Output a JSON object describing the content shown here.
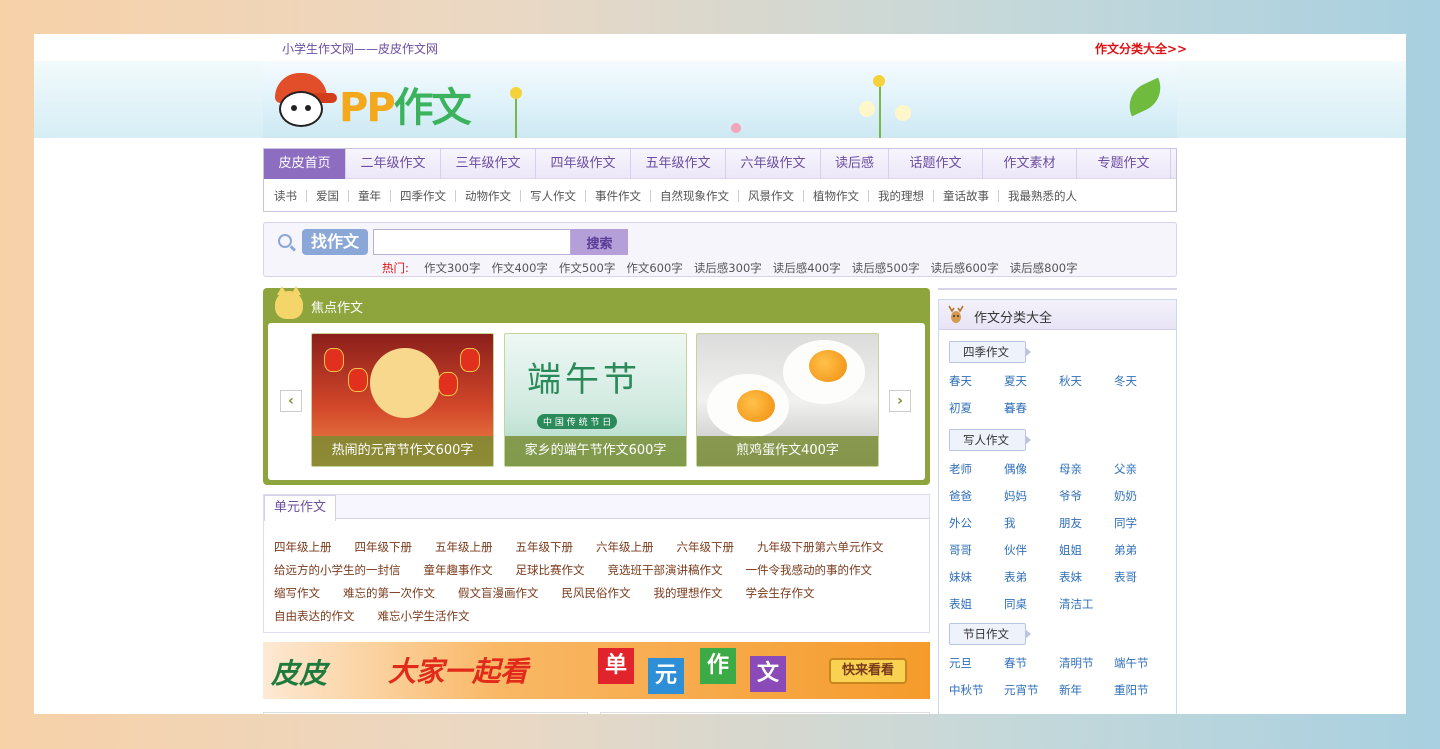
{
  "topbar": {
    "site_name": "小学生作文网——皮皮作文网",
    "all_categories": "作文分类大全>>"
  },
  "logo": {
    "pp": "PP",
    "zuowen": "作文"
  },
  "nav": {
    "main": [
      "皮皮首页",
      "二年级作文",
      "三年级作文",
      "四年级作文",
      "五年级作文",
      "六年级作文",
      "读后感",
      "话题作文",
      "作文素材",
      "专题作文"
    ],
    "sub": [
      "读书",
      "爱国",
      "童年",
      "四季作文",
      "动物作文",
      "写人作文",
      "事件作文",
      "自然现象作文",
      "风景作文",
      "植物作文",
      "我的理想",
      "童话故事",
      "我最熟悉的人"
    ]
  },
  "search": {
    "find_label": "找作文",
    "placeholder": "",
    "button": "搜索",
    "hot_label": "热门:",
    "hot": [
      "作文300字",
      "作文400字",
      "作文500字",
      "作文600字",
      "读后感300字",
      "读后感400字",
      "读后感500字",
      "读后感600字",
      "读后感800字"
    ]
  },
  "focus": {
    "title": "焦点作文",
    "prev": "‹",
    "next": "›",
    "slides": [
      {
        "caption": "热闹的元宵节作文600字"
      },
      {
        "caption": "家乡的端午节作文600字",
        "art_text": "端午节",
        "art_sub": "中 国 传 统 节 日"
      },
      {
        "caption": "煎鸡蛋作文400字"
      }
    ]
  },
  "unit": {
    "tab": "单元作文",
    "rows": [
      [
        "四年级上册",
        "四年级下册",
        "五年级上册",
        "五年级下册",
        "六年级上册",
        "六年级下册",
        "九年级下册第六单元作文"
      ],
      [
        "给远方的小学生的一封信",
        "童年趣事作文",
        "足球比赛作文",
        "竞选班干部演讲稿作文",
        "一件令我感动的事的作文"
      ],
      [
        "缩写作文",
        "难忘的第一次作文",
        "假文盲漫画作文",
        "民风民俗作文",
        "我的理想作文",
        "学会生存作文"
      ],
      [
        "自由表达的作文",
        "难忘小学生活作文"
      ]
    ]
  },
  "ad": {
    "pi": "皮皮",
    "slogan": "大家一起看",
    "boxes": [
      "单",
      "元",
      "作",
      "文"
    ],
    "button": "快来看看"
  },
  "sidebar": {
    "title": "作文分类大全",
    "groups": [
      {
        "label": "四季作文",
        "items": [
          "春天",
          "夏天",
          "秋天",
          "冬天",
          "初夏",
          "暮春"
        ]
      },
      {
        "label": "写人作文",
        "items": [
          "老师",
          "偶像",
          "母亲",
          "父亲",
          "爸爸",
          "妈妈",
          "爷爷",
          "奶奶",
          "外公",
          "我",
          "朋友",
          "同学",
          "哥哥",
          "伙伴",
          "姐姐",
          "弟弟",
          "妹妹",
          "表弟",
          "表妹",
          "表哥",
          "表姐",
          "同桌",
          "清洁工"
        ]
      },
      {
        "label": "节日作文",
        "items": [
          "元旦",
          "春节",
          "清明节",
          "端午节",
          "中秋节",
          "元宵节",
          "新年",
          "重阳节"
        ]
      }
    ]
  },
  "colors": {
    "accent": "#8c6dc0",
    "focus_bg": "#8ea43c",
    "link_red": "#dd1111",
    "sidebar_link": "#2f6fb8"
  }
}
